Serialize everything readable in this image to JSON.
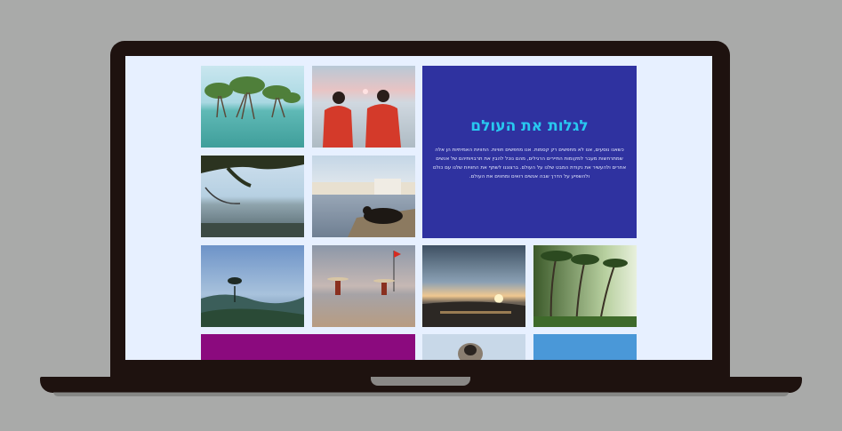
{
  "hero": {
    "title": "לגלות את העולם",
    "body": "כשאנו נוסעים, אנו לא מחפשים רק קסמות. אנו מחפשים חוויות. החוויות האמיתיות הן אלה שמתרחשות מעבר למקומות התיירים הרגילים, מהם נוכל להבין את תרבויותיהם של אנשים אחרים ולהעשיר את נקודת המבט שלנו על העולם. ברצוננו לשתף את החוויות שלנו עם כולם ולהשפיע על הדרך שבה אנשים רואים ומחווים את העולם."
  },
  "colors": {
    "hero_bg": "#2f32a0",
    "hero_title": "#28c8f0",
    "magenta_tile": "#8b0a7e",
    "screen_bg": "#e7f0ff"
  },
  "photos": [
    {
      "name": "photo-mangrove-trees-in-water"
    },
    {
      "name": "photo-two-women-in-red-saris"
    },
    {
      "name": "photo-hammock-by-the-sea"
    },
    {
      "name": "photo-cow-by-lake-town"
    },
    {
      "name": "photo-misty-valley-tree"
    },
    {
      "name": "photo-beach-people-red-flag"
    },
    {
      "name": "photo-sunset-over-lake"
    },
    {
      "name": "photo-palm-grove-sunlight"
    },
    {
      "name": "photo-monkey"
    },
    {
      "name": "photo-blue-sky"
    }
  ]
}
